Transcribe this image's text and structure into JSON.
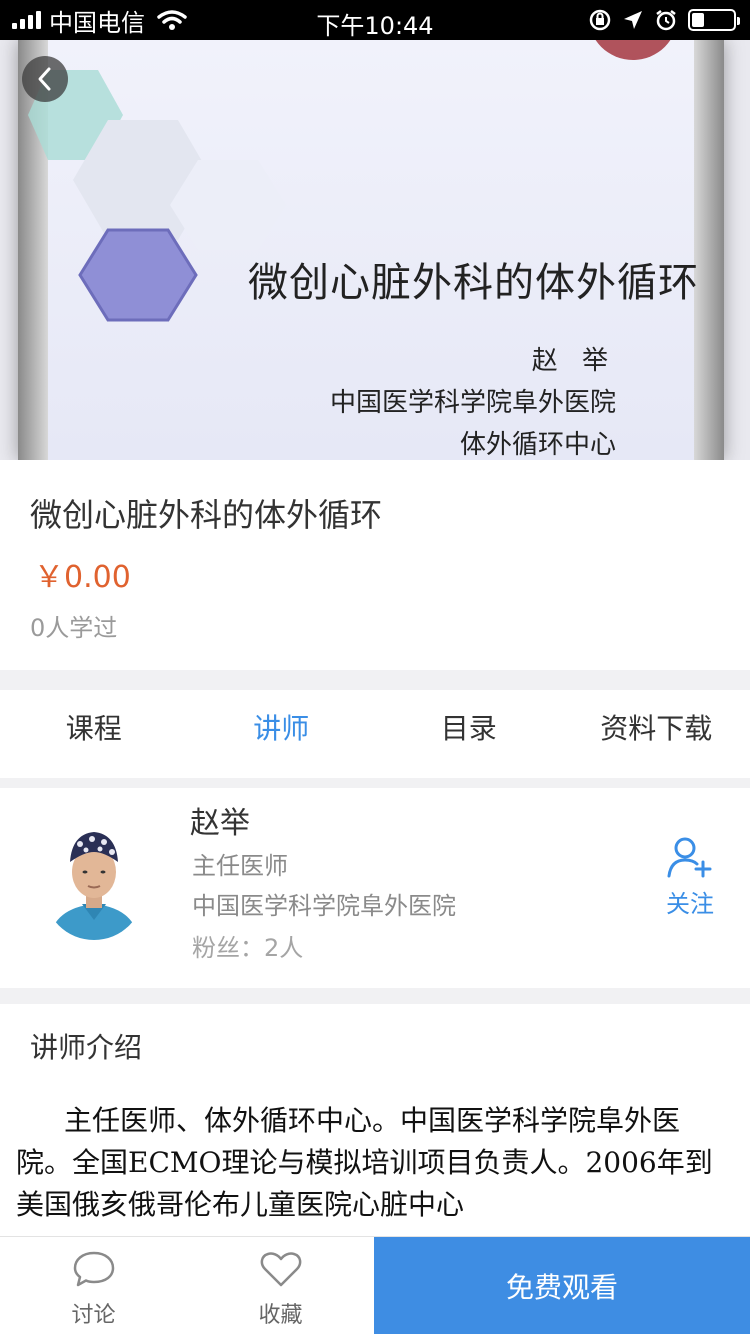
{
  "status_bar": {
    "carrier": "中国电信",
    "time": "下午10:44"
  },
  "hero": {
    "slide_title": "微创心脏外科的体外循环",
    "slide_author": "赵 举",
    "slide_institution": "中国医学科学院阜外医院",
    "slide_department": "体外循环中心"
  },
  "course": {
    "title": "微创心脏外科的体外循环",
    "price": "￥0.00",
    "learners": "0人学过"
  },
  "tabs": [
    {
      "label": "课程",
      "active": false
    },
    {
      "label": "讲师",
      "active": true
    },
    {
      "label": "目录",
      "active": false
    },
    {
      "label": "资料下载",
      "active": false
    }
  ],
  "lecturer": {
    "name": "赵举",
    "title": "主任医师",
    "institution": "中国医学科学院阜外医院",
    "fans": "粉丝：2人",
    "follow_label": "关注"
  },
  "intro": {
    "heading": "讲师介绍",
    "text": "主任医师、体外循环中心。中国医学科学院阜外医院。全国ECMO理论与模拟培训项目负责人。2006年到美国俄亥俄哥伦布儿童医院心脏中心"
  },
  "bottom_bar": {
    "discuss_label": "讨论",
    "favorite_label": "收藏",
    "watch_label": "免费观看"
  },
  "colors": {
    "accent": "#3a8ee6",
    "price": "#e0622f",
    "watch_button": "#3e8de3"
  }
}
